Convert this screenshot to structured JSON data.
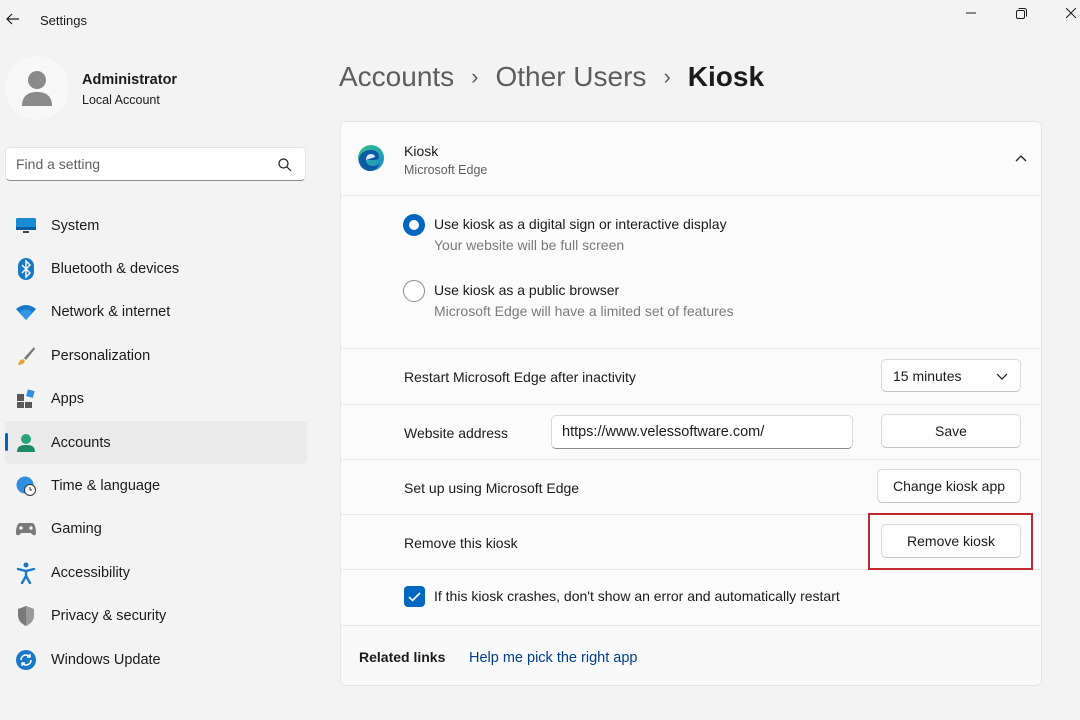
{
  "window": {
    "title": "Settings",
    "back_icon": "arrow-left-icon",
    "controls": [
      "minimize-icon",
      "restore-icon",
      "close-icon"
    ]
  },
  "profile": {
    "name": "Administrator",
    "account_type": "Local Account"
  },
  "search": {
    "placeholder": "Find a setting",
    "value": ""
  },
  "sidebar": {
    "items": [
      {
        "label": "System",
        "icon": "monitor-icon"
      },
      {
        "label": "Bluetooth & devices",
        "icon": "bluetooth-icon"
      },
      {
        "label": "Network & internet",
        "icon": "wifi-icon"
      },
      {
        "label": "Personalization",
        "icon": "brush-icon"
      },
      {
        "label": "Apps",
        "icon": "apps-icon"
      },
      {
        "label": "Accounts",
        "icon": "person-icon",
        "active": true
      },
      {
        "label": "Time & language",
        "icon": "globe-clock-icon"
      },
      {
        "label": "Gaming",
        "icon": "controller-icon"
      },
      {
        "label": "Accessibility",
        "icon": "accessibility-icon"
      },
      {
        "label": "Privacy & security",
        "icon": "shield-icon"
      },
      {
        "label": "Windows Update",
        "icon": "update-icon"
      }
    ]
  },
  "breadcrumb": {
    "items": [
      "Accounts",
      "Other Users"
    ],
    "current": "Kiosk",
    "separator": "›"
  },
  "kiosk": {
    "title": "Kiosk",
    "app": "Microsoft Edge",
    "options": [
      {
        "label": "Use kiosk as a digital sign or interactive display",
        "sub": "Your website will be full screen",
        "selected": true
      },
      {
        "label": "Use kiosk as a public browser",
        "sub": "Microsoft Edge will have a limited set of features",
        "selected": false
      }
    ],
    "restart": {
      "label": "Restart Microsoft Edge after inactivity",
      "value": "15 minutes"
    },
    "website": {
      "label": "Website address",
      "value": "https://www.velessoftware.com/",
      "button": "Save"
    },
    "setup": {
      "label": "Set up using Microsoft Edge",
      "button": "Change kiosk app"
    },
    "remove": {
      "label": "Remove this kiosk",
      "button": "Remove kiosk"
    },
    "crash": {
      "label": "If this kiosk crashes, don't show an error and automatically restart",
      "checked": true
    }
  },
  "related": {
    "title": "Related links",
    "link": "Help me pick the right app"
  },
  "colors": {
    "accent": "#0067c0",
    "highlight": "#c0282f",
    "link": "#003e92"
  }
}
